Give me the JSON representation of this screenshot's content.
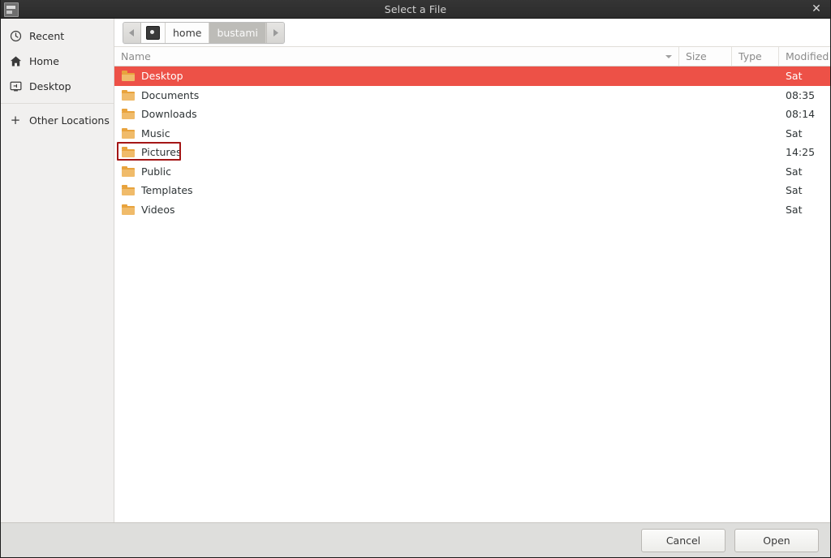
{
  "titlebar": {
    "title": "Select a File",
    "app_icon": "application-icon",
    "close_label": "✕"
  },
  "sidebar": {
    "items": [
      {
        "label": "Recent",
        "icon": "clock-icon"
      },
      {
        "label": "Home",
        "icon": "home-icon"
      },
      {
        "label": "Desktop",
        "icon": "desktop-icon"
      }
    ],
    "other": {
      "label": "Other Locations",
      "icon": "plus-icon"
    }
  },
  "pathbar": {
    "back_arrow": "◀",
    "forward_arrow": "▶",
    "device_icon": "computer-icon",
    "crumbs": [
      {
        "label": "home",
        "active": false
      },
      {
        "label": "bustami",
        "active": true
      }
    ]
  },
  "columns": {
    "name": "Name",
    "size": "Size",
    "type": "Type",
    "modified": "Modified"
  },
  "files": [
    {
      "name": "Desktop",
      "size": "",
      "type": "",
      "modified": "Sat",
      "selected": true,
      "annotated": false
    },
    {
      "name": "Documents",
      "size": "",
      "type": "",
      "modified": "08:35",
      "selected": false,
      "annotated": false
    },
    {
      "name": "Downloads",
      "size": "",
      "type": "",
      "modified": "08:14",
      "selected": false,
      "annotated": false
    },
    {
      "name": "Music",
      "size": "",
      "type": "",
      "modified": "Sat",
      "selected": false,
      "annotated": false
    },
    {
      "name": "Pictures",
      "size": "",
      "type": "",
      "modified": "14:25",
      "selected": false,
      "annotated": true
    },
    {
      "name": "Public",
      "size": "",
      "type": "",
      "modified": "Sat",
      "selected": false,
      "annotated": false
    },
    {
      "name": "Templates",
      "size": "",
      "type": "",
      "modified": "Sat",
      "selected": false,
      "annotated": false
    },
    {
      "name": "Videos",
      "size": "",
      "type": "",
      "modified": "Sat",
      "selected": false,
      "annotated": false
    }
  ],
  "actions": {
    "cancel": "Cancel",
    "open": "Open"
  },
  "colors": {
    "selection": "#ed5147",
    "annotation": "#a41616",
    "titlebar": "#2e2e2e",
    "sidebar": "#f1f0ef",
    "actionbar": "#dededc",
    "folder": "#f0bb6a"
  }
}
